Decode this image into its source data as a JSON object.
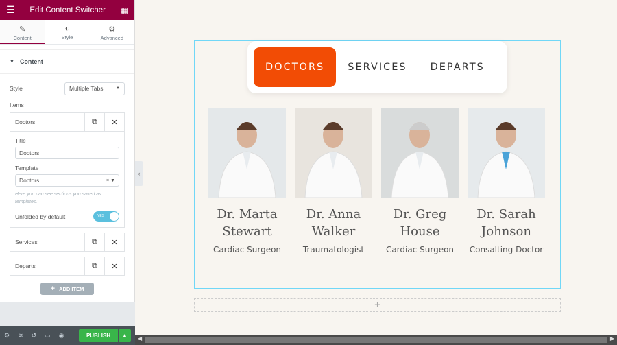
{
  "sidebar": {
    "title": "Edit Content Switcher",
    "tabs": [
      {
        "label": "Content",
        "icon": "pencil-icon"
      },
      {
        "label": "Style",
        "icon": "contrast-icon"
      },
      {
        "label": "Advanced",
        "icon": "gear-icon"
      }
    ],
    "section": "Content",
    "style_label": "Style",
    "style_value": "Multiple Tabs",
    "items_label": "Items",
    "items": [
      {
        "label": "Doctors"
      },
      {
        "label": "Services"
      },
      {
        "label": "Departs"
      }
    ],
    "panel": {
      "title_label": "Title",
      "title_value": "Doctors",
      "template_label": "Template",
      "template_value": "Doctors",
      "hint": "Here you can see sections you saved as templates.",
      "unfold_label": "Unfolded by default",
      "toggle_text": "YES"
    },
    "add_item": "ADD ITEM",
    "publish": "PUBLISH"
  },
  "switcher": {
    "tabs": [
      "DOCTORS",
      "SERVICES",
      "DEPARTS"
    ],
    "active": 0,
    "accent": "#f24c05"
  },
  "doctors": [
    {
      "name": "Dr. Marta Stewart",
      "role": "Cardiac Surgeon"
    },
    {
      "name": "Dr. Anna Walker",
      "role": "Traumatologist"
    },
    {
      "name": "Dr. Greg House",
      "role": "Cardiac Surgeon"
    },
    {
      "name": "Dr. Sarah Johnson",
      "role": "Consalting Doctor"
    }
  ],
  "colors": {
    "header": "#93003f",
    "publish": "#39b54a"
  }
}
